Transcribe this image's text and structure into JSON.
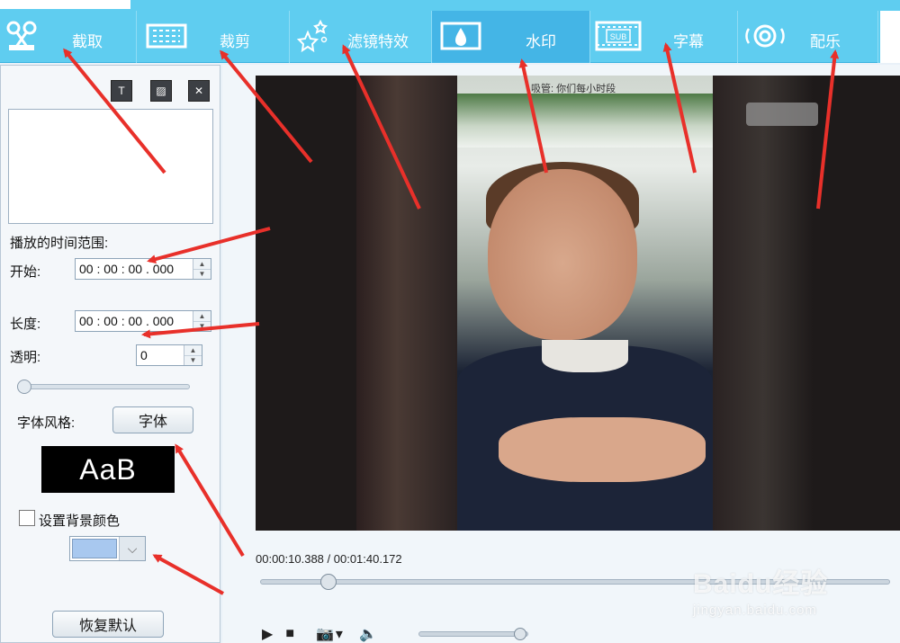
{
  "tabs": [
    {
      "key": "capture",
      "label": "截取",
      "icon": "scissors-icon"
    },
    {
      "key": "crop",
      "label": "裁剪",
      "icon": "crop-frame-icon"
    },
    {
      "key": "filter",
      "label": "滤镜特效",
      "icon": "stars-icon"
    },
    {
      "key": "watermark",
      "label": "水印",
      "icon": "droplet-icon",
      "active": true
    },
    {
      "key": "subtitle",
      "label": "字幕",
      "icon": "subtitle-film-icon",
      "icon_text": "SUB"
    },
    {
      "key": "music",
      "label": "配乐",
      "icon": "speaker-wave-icon"
    }
  ],
  "left_panel": {
    "tool_buttons": [
      "add-text-icon",
      "add-image-icon",
      "close-icon"
    ],
    "tool_close_glyph": "✕",
    "tool_add_glyph": "T",
    "tool_img_glyph": "▨",
    "time_range_label": "播放的时间范围:",
    "start_label": "开始:",
    "start_value": "00 : 00 : 00 . 000",
    "length_label": "长度:",
    "length_value": "00 : 00 : 00 . 000",
    "opacity_label": "透明:",
    "opacity_value": "0",
    "opacity_slider": 0,
    "font_style_label": "字体风格:",
    "font_button": "字体",
    "font_preview": "AaB",
    "bg_color_label": "设置背景颜色",
    "bg_color_checked": false,
    "bg_color": "#a8c8ef",
    "restore_button": "恢复默认",
    "spin_up": "▲",
    "spin_down": "▼",
    "drop_glyph": "⌵"
  },
  "player": {
    "time_display": "00:00:10.388 / 00:01:40.172",
    "progress_fraction": 0.1037,
    "caption_text": "吸管: 你们每小时段",
    "controls": {
      "play": "▶",
      "stop": "■",
      "snapshot": "📷",
      "snapshot_menu": "▾",
      "volume": "🔈"
    },
    "volume_fraction": 0.95
  },
  "watermark_overlay": {
    "brand": "Baidu经验",
    "site": "jingyan.baidu.com"
  },
  "colors": {
    "tab_bar": "#5fcdf0",
    "tab_active": "#44b5e6",
    "arrow": "#e8302a"
  }
}
